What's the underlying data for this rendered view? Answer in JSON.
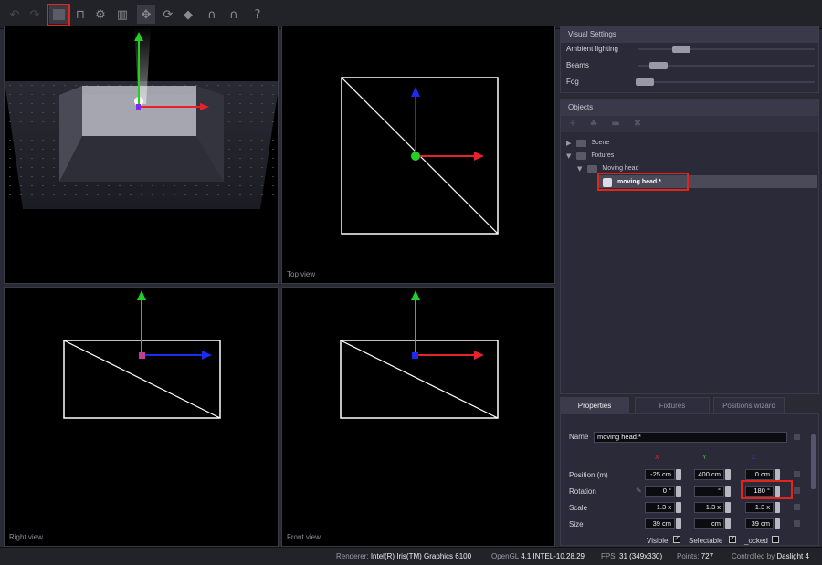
{
  "toolbar": {
    "icons": [
      "undo-icon",
      "redo-icon",
      "single-view-icon",
      "four-view-icon",
      "settings-icon",
      "stats-icon",
      "move-icon",
      "rotate-icon",
      "snap-icon",
      "magnet-icon",
      "magnet-alt-icon",
      "help-icon"
    ]
  },
  "viewports": {
    "perspective": {
      "label": ""
    },
    "top": {
      "label": "Top view"
    },
    "right": {
      "label": "Right view"
    },
    "front": {
      "label": "Front view"
    }
  },
  "visual_settings": {
    "title": "Visual Settings",
    "rows": [
      {
        "label": "Ambient lighting",
        "level": 0.28
      },
      {
        "label": "Beams",
        "level": 0.16
      },
      {
        "label": "Fog",
        "level": 0.05
      }
    ]
  },
  "objects": {
    "title": "Objects",
    "tree": [
      {
        "label": "Scene"
      },
      {
        "label": "Fixtures"
      },
      {
        "label": "Moving head"
      },
      {
        "label": "moving head.*"
      }
    ]
  },
  "tabs": {
    "properties": "Properties",
    "fixtures": "Fixtures",
    "positions_wizard": "Positions wizard"
  },
  "properties": {
    "name_label": "Name",
    "name_value": "moving head.*",
    "axes": {
      "x": "X",
      "y": "Y",
      "z": "Z"
    },
    "position": {
      "label": "Position (m)",
      "x": "-25 cm",
      "y": "400 cm",
      "z": "0 cm"
    },
    "rotation": {
      "label": "Rotation",
      "x": "0 °",
      "y": "°",
      "z": "180 °"
    },
    "scale": {
      "label": "Scale",
      "x": "1.3 x",
      "y": "1.3 x",
      "z": "1.3 x"
    },
    "size": {
      "label": "Size",
      "x": "39 cm",
      "y": "cm",
      "z": "39 cm"
    },
    "visible_label": "Visible",
    "selectable_label": "Selectable",
    "locked_label": "_ocked"
  },
  "status": {
    "renderer_label": "Renderer:",
    "renderer_value": "Intel(R) Iris(TM) Graphics 6100",
    "opengl_label": "OpenGL",
    "opengl_value": "4.1 INTEL-10.28.29",
    "fps_label": "FPS:",
    "fps_value": "31 (349x330)",
    "points_label": "Points:",
    "points_value": "727",
    "controlled_label": "Controlled by",
    "controlled_value": "Daslight 4"
  },
  "colors": {
    "x_axis": "#e8222a",
    "y_axis": "#22d022",
    "z_axis": "#1a2cf0",
    "highlight": "#e3241b"
  }
}
